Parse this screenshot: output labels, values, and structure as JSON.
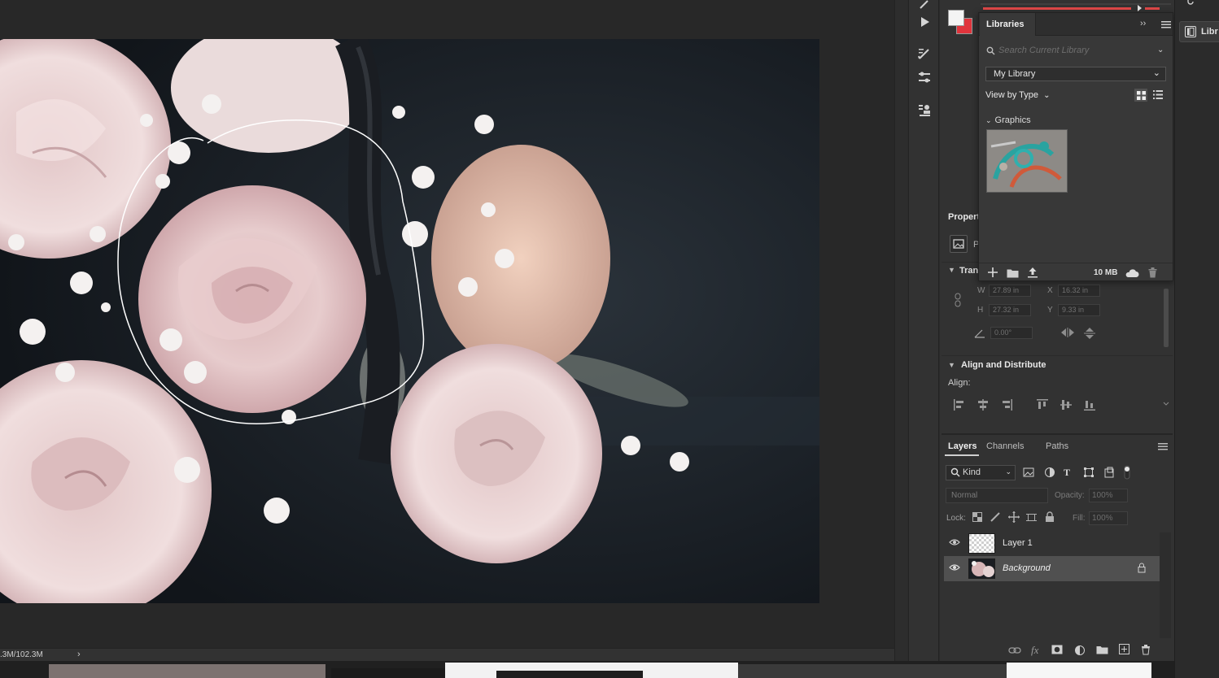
{
  "status": {
    "doc_size": ".3M/102.3M"
  },
  "libraries": {
    "tab_label": "Libraries",
    "search_placeholder": "Search Current Library",
    "library_name": "My Library",
    "view_by": "View by Type",
    "section": "Graphics",
    "storage": "10 MB"
  },
  "properties": {
    "title": "Propert",
    "layer_type": "P",
    "transform_title": "Tran",
    "w_value": "27.89 in",
    "x_value": "16.32 in",
    "h_value": "27.32 in",
    "y_value": "9.33 in",
    "angle_value": "0.00°",
    "w_label": "W",
    "h_label": "H",
    "x_label": "X",
    "y_label": "Y"
  },
  "align": {
    "title": "Align and Distribute",
    "label": "Align:"
  },
  "layers_panel": {
    "tabs": [
      "Layers",
      "Channels",
      "Paths"
    ],
    "kind": "Kind",
    "blend_mode": "Normal",
    "opacity_label": "Opacity:",
    "opacity_value": "100%",
    "lock_label": "Lock:",
    "fill_label": "Fill:",
    "fill_value": "100%",
    "layers": [
      {
        "name": "Layer 1"
      },
      {
        "name": "Background"
      }
    ]
  },
  "far_right": {
    "libraries_button": "Libr"
  },
  "colors": {
    "foreground": "#f4f4f4",
    "background": "#e0343c",
    "selection_stroke": "#ffffff",
    "panel": "#323232"
  }
}
